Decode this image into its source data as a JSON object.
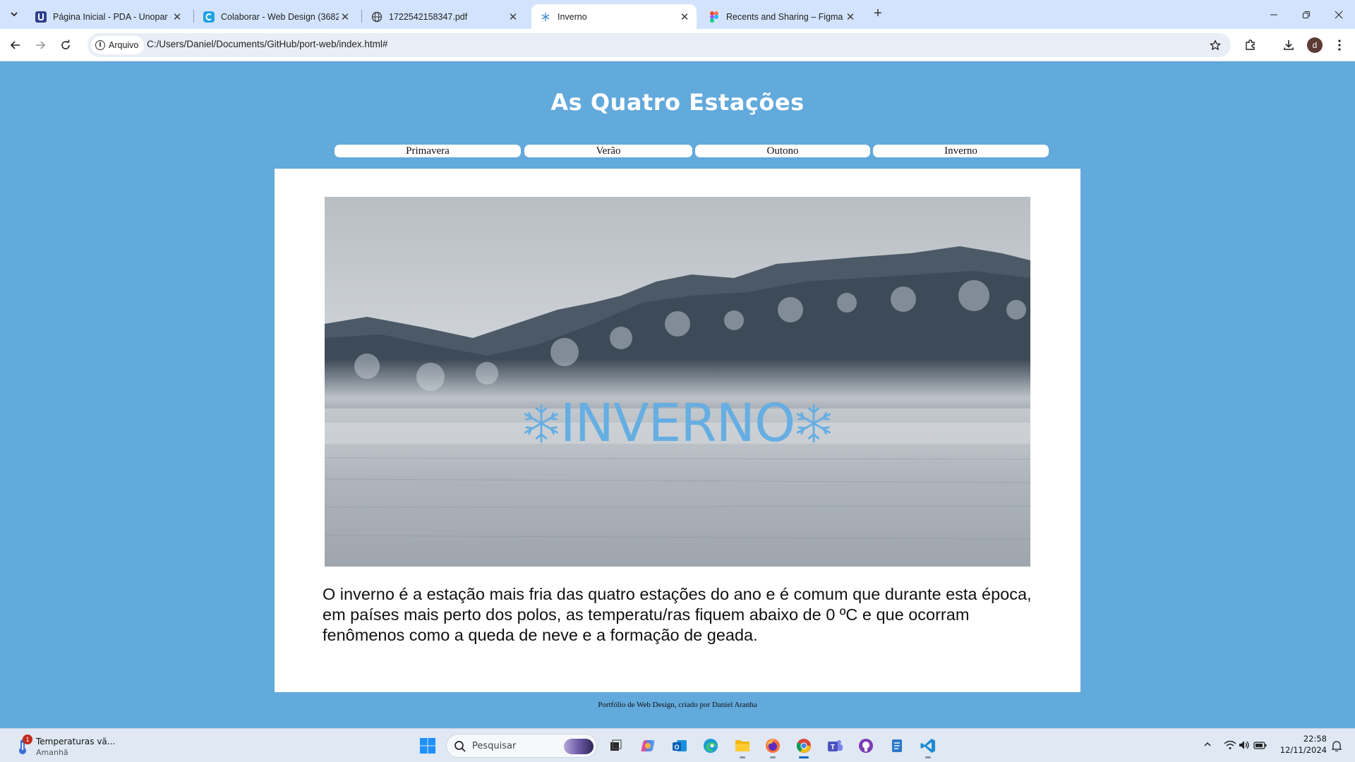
{
  "browser": {
    "tabs": [
      {
        "title": "Página Inicial - PDA - Unopar - ",
        "favicon": "unopar-icon",
        "active": false
      },
      {
        "title": "Colaborar - Web Design (3682",
        "favicon": "colaborar-icon",
        "active": false
      },
      {
        "title": "1722542158347.pdf",
        "favicon": "globe-icon",
        "active": false
      },
      {
        "title": "Inverno",
        "favicon": "snowflake-icon",
        "active": true
      },
      {
        "title": "Recents and Sharing – Figma",
        "favicon": "figma-icon",
        "active": false
      }
    ],
    "site_chip": "Arquivo",
    "url": "C:/Users/Daniel/Documents/GitHub/port-web/index.html#",
    "avatar_letter": "d"
  },
  "page": {
    "title": "As Quatro Estações",
    "nav": [
      "Primavera",
      "Verão",
      "Outono",
      "Inverno"
    ],
    "hero_text": "INVERNO",
    "paragraph": "O inverno é a estação mais fria das quatro estações do ano e é comum que durante esta época, em países mais perto dos polos, as temperatu/ras fiquem abaixo de 0 ºC e que ocorram fenômenos como a queda de neve e a formação de geada.",
    "footer": "Portfólio de Web Design, criado por Daniel Aranha"
  },
  "taskbar": {
    "weather_title": "Temperaturas vã...",
    "weather_sub": "Amanhã",
    "weather_badge": "1",
    "search_placeholder": "Pesquisar",
    "time": "22:58",
    "date": "12/11/2024"
  },
  "colors": {
    "page_background": "#62a9dc",
    "hero_text": "#66aee2",
    "card": "#ffffff"
  }
}
